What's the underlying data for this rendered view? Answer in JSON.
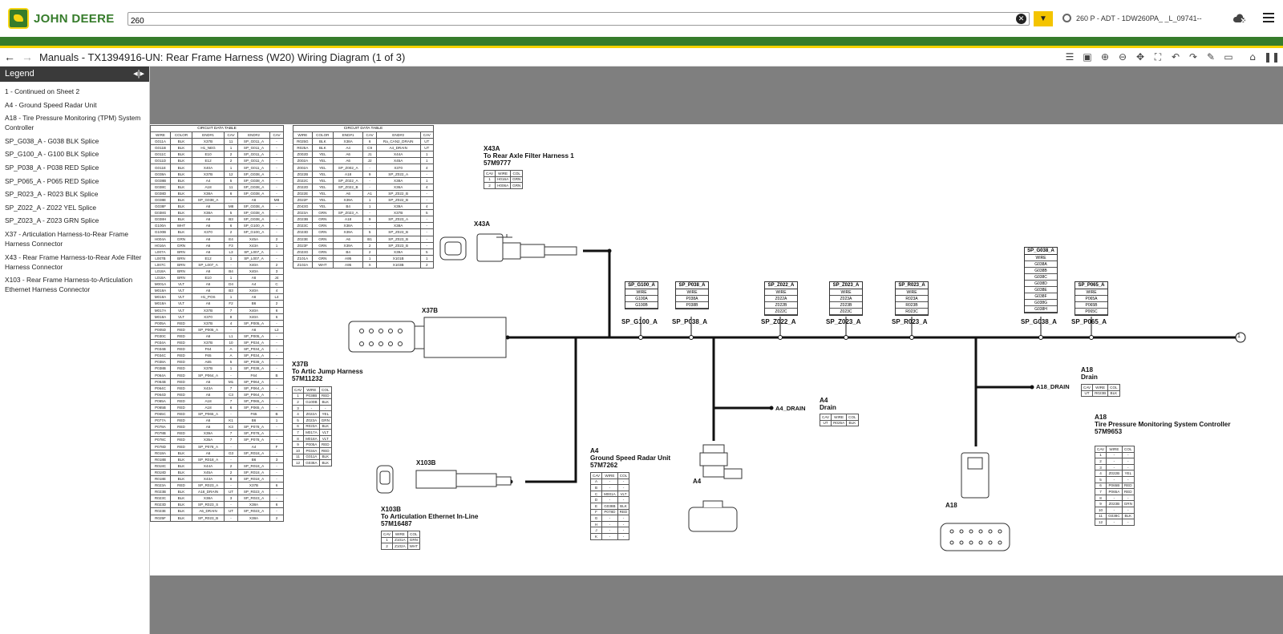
{
  "header": {
    "brand": "JOHN DEERE",
    "search_value": "260",
    "machine_label": "260 P - ADT - 1DW260PA_ _L_09741--",
    "brand_green": "#367c2b",
    "brand_yellow": "#f4d200"
  },
  "titlebar": {
    "title": "Manuals - TX1394916-UN: Rear Frame Harness (W20) Wiring Diagram (1 of 3)"
  },
  "legend": {
    "title": "Legend",
    "items": [
      "1 - Continued on Sheet 2",
      "A4 - Ground Speed Radar Unit",
      "A18 - Tire Pressure Monitoring (TPM) System Controller",
      "SP_G038_A - G038 BLK Splice",
      "SP_G100_A - G100 BLK Splice",
      "SP_P038_A - P038 RED Splice",
      "SP_P065_A - P065 RED Splice",
      "SP_R023_A - R023 BLK Splice",
      "SP_Z022_A - Z022 YEL Splice",
      "SP_Z023_A - Z023 GRN Splice",
      "X37 - Articulation Harness-to-Rear Frame Harness Connector",
      "X43 - Rear Frame Harness-to-Rear Axle Filter Harness Connector",
      "X103 - Rear Frame Harness-to-Articulation Ethernet Harness Connector"
    ]
  },
  "diagram": {
    "table_caption": "CIRCUIT DATA TABLE",
    "table_headers": [
      "WIRE",
      "COLOR",
      "END#1",
      "CAV",
      "END#2",
      "CAV"
    ],
    "table1_rows": [
      [
        "G011A",
        "BLK",
        "X37B",
        "11",
        "SP_G011_A",
        "-"
      ],
      [
        "G011B",
        "BLK",
        "H1_NEG",
        "1",
        "SP_G011_A",
        "-"
      ],
      [
        "G011C",
        "BLK",
        "E10",
        "2",
        "SP_G011_A",
        "-"
      ],
      [
        "G011D",
        "BLK",
        "E12",
        "2",
        "SP_G011_A",
        "-"
      ],
      [
        "G011E",
        "BLK",
        "X40A",
        "1",
        "SP_G011_A",
        "-"
      ],
      [
        "G038A",
        "BLK",
        "X37B",
        "12",
        "SP_G038_A",
        "-"
      ],
      [
        "G038B",
        "BLK",
        "A4",
        "5",
        "SP_G038_A",
        "-"
      ],
      [
        "G038C",
        "BLK",
        "A18",
        "11",
        "SP_G038_A",
        "-"
      ],
      [
        "G038D",
        "BLK",
        "X38A",
        "6",
        "SP_G038_A",
        "-"
      ],
      [
        "G038E",
        "BLK",
        "SP_G038_A",
        "-",
        "A6",
        "M8"
      ],
      [
        "G038F",
        "BLK",
        "A6",
        "M8",
        "SP_G038_A",
        "-"
      ],
      [
        "G038G",
        "BLK",
        "X38A",
        "5",
        "SP_G038_A",
        "-"
      ],
      [
        "G038H",
        "BLK",
        "A6",
        "B3",
        "SP_G038_A",
        "-"
      ],
      [
        "G100A",
        "WHT",
        "A6",
        "6",
        "SP_G100_A",
        "-"
      ],
      [
        "G100B",
        "BLK",
        "X370",
        "2",
        "SP_G100_A",
        "-"
      ],
      [
        "H004A",
        "GRN",
        "A6",
        "E4",
        "X45A",
        "2"
      ],
      [
        "H016A",
        "GRN",
        "A6",
        "F3",
        "X43A",
        "1"
      ],
      [
        "L007A",
        "BRN",
        "A6",
        "L3",
        "SP_L007_A",
        "-"
      ],
      [
        "L007B",
        "BRN",
        "E12",
        "1",
        "SP_L007_A",
        "-"
      ],
      [
        "L007C",
        "BRN",
        "SP_L007_A",
        "-",
        "X40A",
        "2"
      ],
      [
        "L018A",
        "BRN",
        "A6",
        "B4",
        "X40A",
        "3"
      ],
      [
        "L018A",
        "BRN",
        "E10",
        "1",
        "A6",
        "J4"
      ],
      [
        "M001A",
        "VLT",
        "A6",
        "D4",
        "A4",
        "C"
      ],
      [
        "M018A",
        "VLT",
        "A6",
        "B3",
        "X40A",
        "4"
      ],
      [
        "M018A",
        "VLT",
        "H1_POS",
        "1",
        "A6",
        "L4"
      ],
      [
        "M018A",
        "VLT",
        "A6",
        "F2",
        "B6",
        "2"
      ],
      [
        "M017A",
        "VLT",
        "X37B",
        "7",
        "X40A",
        "6"
      ],
      [
        "M018A",
        "VLT",
        "X370",
        "8",
        "X40A",
        "6"
      ],
      [
        "P005A",
        "RED",
        "X37B",
        "4",
        "SP_P005_A",
        "-"
      ],
      [
        "P005D",
        "RED",
        "SP_P005_A",
        "-",
        "A6",
        "L2"
      ],
      [
        "P030C",
        "RED",
        "A6",
        "L1",
        "SP_P005_A",
        "-"
      ],
      [
        "P034A",
        "RED",
        "X37B",
        "10",
        "SP_P034_A",
        "-"
      ],
      [
        "P034B",
        "RED",
        "F64",
        "A",
        "SP_P034_A",
        "-"
      ],
      [
        "P034C",
        "RED",
        "F65",
        "A",
        "SP_P034_A",
        "-"
      ],
      [
        "P038A",
        "RED",
        "A65",
        "5",
        "SP_P038_A",
        "-"
      ],
      [
        "P038B",
        "RED",
        "X37B",
        "1",
        "SP_P038_A",
        "-"
      ],
      [
        "P064A",
        "RED",
        "SP_P064_A",
        "-",
        "F64",
        "B"
      ],
      [
        "P064B",
        "RED",
        "A6",
        "M1",
        "SP_P064_A",
        "-"
      ],
      [
        "P064C",
        "RED",
        "X43A",
        "7",
        "SP_P064_A",
        "-"
      ],
      [
        "P064D",
        "RED",
        "A6",
        "C3",
        "SP_P064_A",
        "-"
      ],
      [
        "P065A",
        "RED",
        "A18",
        "7",
        "SP_P065_A",
        "-"
      ],
      [
        "P065B",
        "RED",
        "A18",
        "6",
        "SP_P065_A",
        "-"
      ],
      [
        "P065C",
        "RED",
        "SP_P065_A",
        "-",
        "F65",
        "B"
      ],
      [
        "P077A",
        "RED",
        "A6",
        "K1",
        "B6",
        "1"
      ],
      [
        "P078A",
        "RED",
        "A6",
        "K3",
        "SP_P078_A",
        "-"
      ],
      [
        "P078B",
        "RED",
        "X39A",
        "7",
        "SP_P078_A",
        "-"
      ],
      [
        "P078C",
        "RED",
        "X35A",
        "7",
        "SP_P078_A",
        "-"
      ],
      [
        "P078D",
        "RED",
        "SP_P078_A",
        "-",
        "A4",
        "F"
      ],
      [
        "R018A",
        "BLK",
        "A6",
        "G3",
        "SP_R018_A",
        "-"
      ],
      [
        "R018B",
        "BLK",
        "SP_R018_A",
        "-",
        "B6",
        "3"
      ],
      [
        "R018C",
        "BLK",
        "X44A",
        "2",
        "SP_R018_A",
        "-"
      ],
      [
        "R018D",
        "BLK",
        "X45A",
        "2",
        "SP_R018_A",
        "-"
      ],
      [
        "R018E",
        "BLK",
        "X43A",
        "8",
        "SP_R018_A",
        "-"
      ],
      [
        "R023A",
        "RED",
        "SP_R023_A",
        "-",
        "X37B",
        "6"
      ],
      [
        "R023B",
        "BLK",
        "A18_DRAIN",
        "UT",
        "SP_R023_A",
        "-"
      ],
      [
        "R023C",
        "BLK",
        "X38A",
        "3",
        "SP_R023_A",
        "-"
      ],
      [
        "R023D",
        "BLK",
        "SP_R023_S",
        "-",
        "X38A",
        "6"
      ],
      [
        "R023E",
        "BLK",
        "A6_DRAIN",
        "UT",
        "SP_R023_A",
        "-"
      ],
      [
        "R025F",
        "BLK",
        "SP_R023_B",
        "-",
        "X38A",
        "2"
      ]
    ],
    "table2_rows": [
      [
        "R025G",
        "BLK",
        "X38A",
        "6",
        "Ra_CAN2_DRAIN",
        "UT"
      ],
      [
        "R025A",
        "BLK",
        "A4",
        "C9",
        "A4_DRAIN",
        "UT"
      ],
      [
        "Z002D",
        "YEL",
        "A6",
        "J1",
        "X44A",
        "1"
      ],
      [
        "Z002A",
        "YEL",
        "A6",
        "J2",
        "X45A",
        "1"
      ],
      [
        "Z002A",
        "YEL",
        "SP_Z002_A",
        "-",
        "X370",
        "4"
      ],
      [
        "Z022B",
        "YEL",
        "A18",
        "9",
        "SP_Z022_A",
        "-"
      ],
      [
        "Z022C",
        "YEL",
        "SP_Z022_A",
        "-",
        "X38A",
        "1"
      ],
      [
        "Z022D",
        "YEL",
        "SP_Z022_B",
        "-",
        "X36A",
        "4"
      ],
      [
        "Z022E",
        "YEL",
        "A6",
        "A1",
        "SP_Z022_B",
        "-"
      ],
      [
        "Z022F",
        "YEL",
        "X39A",
        "1",
        "SP_Z022_B",
        "-"
      ],
      [
        "Z043G",
        "YEL",
        "B4",
        "1",
        "X39A",
        "4"
      ],
      [
        "Z023A",
        "GRN",
        "SP_Z023_A",
        "-",
        "X37B",
        "5"
      ],
      [
        "Z023B",
        "GRN",
        "A18",
        "9",
        "SP_Z023_A",
        "-"
      ],
      [
        "Z023C",
        "GRN",
        "X38A",
        "-",
        "X38A",
        "-"
      ],
      [
        "Z023D",
        "GRN",
        "X39A",
        "5",
        "SP_Z023_B",
        "-"
      ],
      [
        "Z023E",
        "GRN",
        "A6",
        "B1",
        "SP_Z023_B",
        "-"
      ],
      [
        "Z023F",
        "GRN",
        "X39A",
        "2",
        "SP_Z023_B",
        "-"
      ],
      [
        "Z023G",
        "GRN",
        "B4",
        "2",
        "X39A",
        "5"
      ],
      [
        "Z101A",
        "GRN",
        "A95",
        "1",
        "X101B",
        "1"
      ],
      [
        "Z102A",
        "WHT",
        "A95",
        "X",
        "X103B",
        "2"
      ]
    ],
    "x43a": {
      "title": "X43A",
      "desc": "To Rear Axle Filter Harness 1",
      "part": "57M9777",
      "headers": [
        "CAV",
        "WIRE",
        "COL"
      ],
      "rows": [
        [
          "1",
          "H016A",
          "GRN"
        ],
        [
          "2",
          "H006A",
          "GRN"
        ]
      ]
    },
    "x37b": {
      "title": "X37B",
      "desc": "To Artic Jump Harness",
      "part": "57M11232",
      "headers": [
        "CAV",
        "WIRE",
        "COL"
      ],
      "rows": [
        [
          "1",
          "P038B",
          "RED"
        ],
        [
          "2",
          "G100B",
          "BLK"
        ],
        [
          "3",
          "-",
          "-"
        ],
        [
          "4",
          "Z022A",
          "YEL"
        ],
        [
          "5",
          "Z023A",
          "GRN"
        ],
        [
          "6",
          "R023A",
          "BLK"
        ],
        [
          "7",
          "M017A",
          "VLT"
        ],
        [
          "8",
          "M018A",
          "VLT"
        ],
        [
          "9",
          "P005A",
          "RED"
        ],
        [
          "10",
          "P034A",
          "RED"
        ],
        [
          "11",
          "G011A",
          "BLK"
        ],
        [
          "12",
          "G038A",
          "BLK"
        ]
      ]
    },
    "x103b": {
      "title": "X103B",
      "desc": "To Articulation Ethernet In-Line",
      "part": "57M16487",
      "headers": [
        "CAV",
        "WIRE",
        "COL"
      ],
      "rows": [
        [
          "1",
          "Z101A",
          "GRN"
        ],
        [
          "2",
          "Z102A",
          "WHT"
        ]
      ]
    },
    "a4": {
      "title": "A4",
      "desc": "Ground Speed Radar Unit",
      "part": "57M7262",
      "headers": [
        "CAV",
        "WIRE",
        "COL"
      ],
      "rows": [
        [
          "A",
          "-",
          "-"
        ],
        [
          "B",
          "-",
          "-"
        ],
        [
          "C",
          "M001A",
          "VLT"
        ],
        [
          "D",
          "-",
          "-"
        ],
        [
          "E",
          "G038B",
          "BLK"
        ],
        [
          "F",
          "P078D",
          "RED"
        ],
        [
          "G",
          "-",
          "-"
        ],
        [
          "H",
          "-",
          "-"
        ],
        [
          "J",
          "-",
          "-"
        ],
        [
          "K",
          "-",
          "-"
        ]
      ]
    },
    "a4_drain": {
      "title": "A4",
      "desc": "Drain",
      "headers": [
        "CAV",
        "WIRE",
        "COL"
      ],
      "rows": [
        [
          "UT",
          "R025A",
          "BLK"
        ]
      ],
      "pin_label": "A4_DRAIN"
    },
    "a18_drain": {
      "title": "A18",
      "desc": "Drain",
      "headers": [
        "CAV",
        "WIRE",
        "COL"
      ],
      "rows": [
        [
          "UT",
          "R023B",
          "BLK"
        ]
      ],
      "pin_label": "A18_DRAIN"
    },
    "a18": {
      "title": "A18",
      "desc": "Tire Pressure Monitoring System Controller",
      "part": "57M9653",
      "headers": [
        "CAV",
        "WIRE",
        "COL"
      ],
      "rows": [
        [
          "1",
          "-",
          "-"
        ],
        [
          "2",
          "-",
          "-"
        ],
        [
          "3",
          "-",
          "-"
        ],
        [
          "4",
          "Z022B",
          "YEL"
        ],
        [
          "5",
          "-",
          "-"
        ],
        [
          "6",
          "P065B",
          "RED"
        ],
        [
          "7",
          "P065A",
          "RED"
        ],
        [
          "8",
          "-",
          "-"
        ],
        [
          "9",
          "Z023B",
          "GRN"
        ],
        [
          "10",
          "-",
          "-"
        ],
        [
          "11",
          "G038C",
          "BLK"
        ],
        [
          "12",
          "-",
          "-"
        ]
      ]
    },
    "connector_labels": {
      "x43a": "X43A",
      "x37b": "X37B",
      "x103b": "X103B",
      "a4": "A4",
      "a18": "A18"
    },
    "splices": [
      {
        "name": "SP_G100_A",
        "rows": [
          "WIRE",
          "G100A",
          "G100B"
        ]
      },
      {
        "name": "SP_P038_A",
        "rows": [
          "WIRE",
          "P038A",
          "P038B"
        ]
      },
      {
        "name": "SP_Z022_A",
        "rows": [
          "WIRE",
          "Z022A",
          "Z022B",
          "Z022C"
        ]
      },
      {
        "name": "SP_Z023_A",
        "rows": [
          "WIRE",
          "Z023A",
          "Z023B",
          "Z023C"
        ]
      },
      {
        "name": "SP_R023_A",
        "rows": [
          "WIRE",
          "R023A",
          "R023B",
          "R023C"
        ]
      },
      {
        "name": "SP_G038_A",
        "rows": [
          "WIRE",
          "G038A",
          "G038B",
          "G038C",
          "G038D",
          "G038E",
          "G038F",
          "G038G",
          "G038H"
        ]
      },
      {
        "name": "SP_P065_A",
        "rows": [
          "WIRE",
          "P065A",
          "P065B",
          "P065C"
        ]
      }
    ],
    "sheet_ref": "1"
  }
}
